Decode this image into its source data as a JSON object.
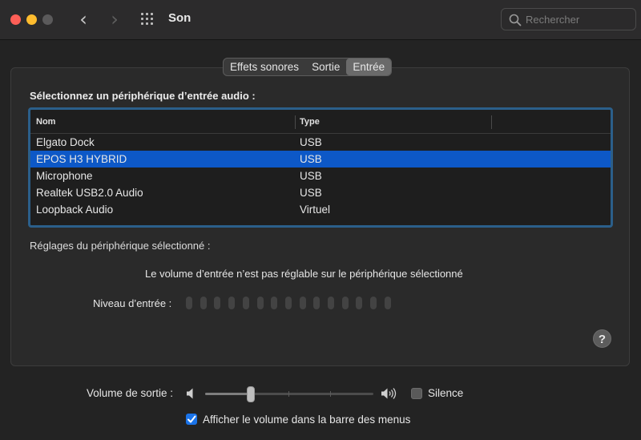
{
  "window": {
    "title": "Son",
    "search_placeholder": "Rechercher"
  },
  "tabs": [
    {
      "label": "Effets sonores",
      "active": false
    },
    {
      "label": "Sortie",
      "active": false
    },
    {
      "label": "Entrée",
      "active": true
    }
  ],
  "input": {
    "section_title": "Sélectionnez un périphérique d’entrée audio :",
    "table": {
      "columns": [
        "Nom",
        "Type"
      ],
      "rows": [
        {
          "name": "Elgato Dock",
          "type": "USB",
          "selected": false
        },
        {
          "name": "EPOS H3 HYBRID",
          "type": "USB",
          "selected": true
        },
        {
          "name": "Microphone",
          "type": "USB",
          "selected": false
        },
        {
          "name": "Realtek USB2.0 Audio",
          "type": "USB",
          "selected": false
        },
        {
          "name": "Loopback Audio",
          "type": "Virtuel",
          "selected": false
        }
      ]
    },
    "settings_label": "Réglages du périphérique sélectionné :",
    "volume_note": "Le volume d’entrée n’est pas réglable sur le périphérique sélectionné",
    "level_label": "Niveau d’entrée :",
    "level_segments": 15,
    "level_active": 0,
    "help_label": "?"
  },
  "output": {
    "volume_label": "Volume de sortie :",
    "volume_fraction": 0.26,
    "silence_label": "Silence",
    "silence_checked": false,
    "show_in_menu_label": "Afficher le volume dans la barre des menus",
    "show_in_menu_checked": true
  },
  "colors": {
    "selection": "#0d58c7",
    "checkbox_accent": "#1a73e8",
    "close": "#fe5f57",
    "minimize": "#febc2e"
  }
}
